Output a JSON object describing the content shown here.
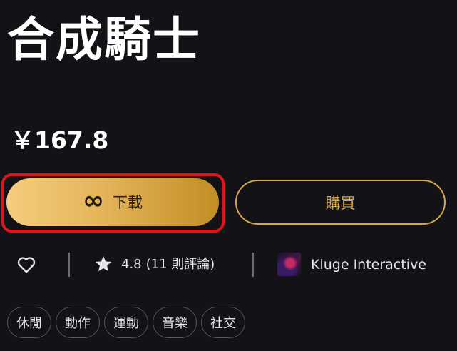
{
  "app": {
    "title": "合成騎士",
    "price": "￥167.8"
  },
  "actions": {
    "download_label": "下載",
    "download_icon": "infinity-icon",
    "buy_label": "購買"
  },
  "info": {
    "rating": "4.8",
    "reviews": "(11 則評論)",
    "developer": "Kluge Interactive"
  },
  "tags": [
    "休閒",
    "動作",
    "運動",
    "音樂",
    "社交"
  ],
  "colors": {
    "background": "#121217",
    "gold": "#d6a647",
    "highlight": "#e0141b"
  }
}
